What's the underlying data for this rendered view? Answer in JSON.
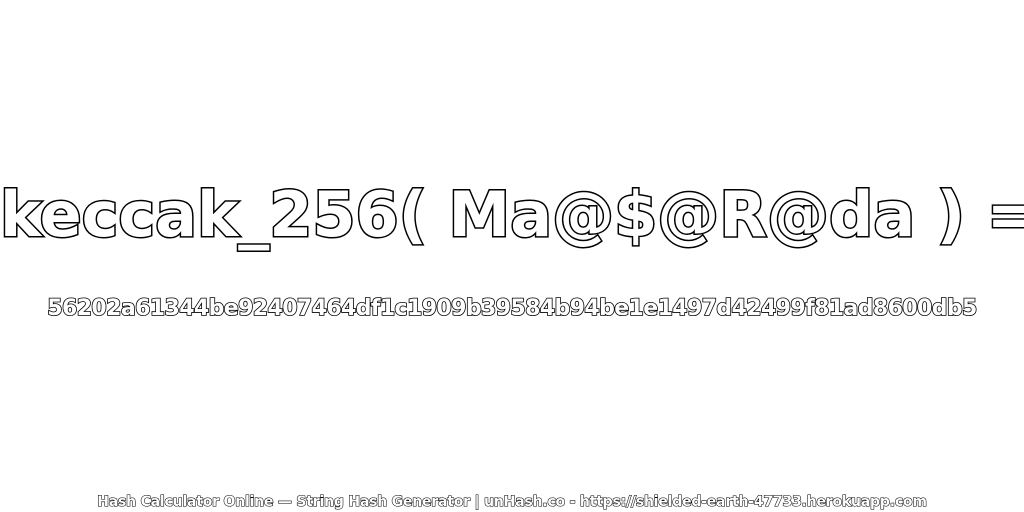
{
  "title": "keccak_256( Ma@$@R@da ) =",
  "hash": "56202a61344be92407464df1c1909b39584b94be1e1497d42499f81ad8600db5",
  "footer": "Hash Calculator Online — String Hash Generator | unHash.co - https://shielded-earth-47733.herokuapp.com"
}
